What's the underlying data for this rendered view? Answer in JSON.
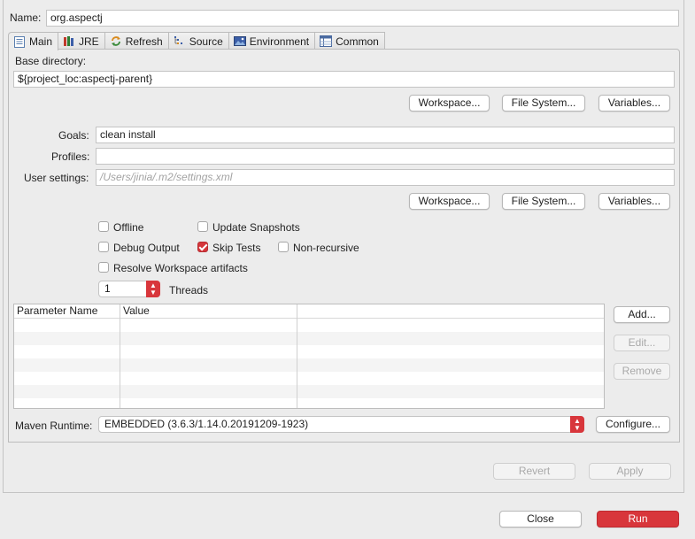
{
  "name": {
    "label": "Name:",
    "value": "org.aspectj"
  },
  "tabs": [
    {
      "label": "Main",
      "icon": "document-icon"
    },
    {
      "label": "JRE",
      "icon": "jre-books-icon"
    },
    {
      "label": "Refresh",
      "icon": "refresh-icon"
    },
    {
      "label": "Source",
      "icon": "source-icon"
    },
    {
      "label": "Environment",
      "icon": "environment-icon"
    },
    {
      "label": "Common",
      "icon": "common-table-icon"
    }
  ],
  "base_directory": {
    "label": "Base directory:",
    "value": "${project_loc:aspectj-parent}"
  },
  "dir_buttons": {
    "workspace": "Workspace...",
    "file_system": "File System...",
    "variables": "Variables..."
  },
  "goals": {
    "label": "Goals:",
    "value": "clean install"
  },
  "profiles": {
    "label": "Profiles:",
    "value": ""
  },
  "user_settings": {
    "label": "User settings:",
    "placeholder": "/Users/jinia/.m2/settings.xml"
  },
  "settings_buttons": {
    "workspace": "Workspace...",
    "file_system": "File System...",
    "variables": "Variables..."
  },
  "options": {
    "offline": {
      "label": "Offline",
      "checked": false
    },
    "update_snapshots": {
      "label": "Update Snapshots",
      "checked": false
    },
    "debug_output": {
      "label": "Debug Output",
      "checked": false
    },
    "skip_tests": {
      "label": "Skip Tests",
      "checked": true
    },
    "non_recursive": {
      "label": "Non-recursive",
      "checked": false
    },
    "resolve_workspace": {
      "label": "Resolve Workspace artifacts",
      "checked": false
    }
  },
  "threads": {
    "value": "1",
    "label": "Threads"
  },
  "params_table": {
    "columns": [
      "Parameter Name",
      "Value"
    ],
    "rows": []
  },
  "param_buttons": {
    "add": "Add...",
    "edit": "Edit...",
    "remove": "Remove"
  },
  "runtime": {
    "label": "Maven Runtime:",
    "value": "EMBEDDED (3.6.3/1.14.0.20191209-1923)",
    "configure": "Configure..."
  },
  "footer": {
    "revert": "Revert",
    "apply": "Apply",
    "close": "Close",
    "run": "Run"
  },
  "colors": {
    "accent": "#d8363b",
    "background": "#ececec"
  }
}
